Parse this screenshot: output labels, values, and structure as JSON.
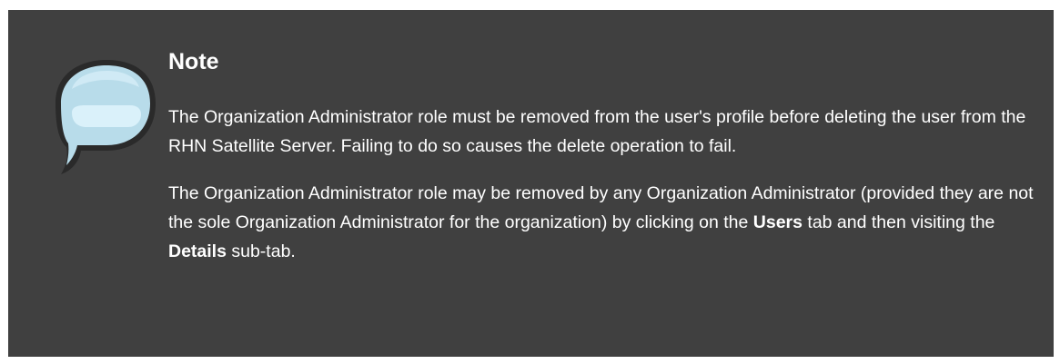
{
  "note": {
    "icon": "speech-bubble-icon",
    "title": "Note",
    "paragraph_1": "The Organization Administrator role must be removed from the user's profile before deleting the user from the RHN Satellite Server. Failing to do so causes the delete operation to fail.",
    "paragraph_2": {
      "text_before_users": "The Organization Administrator role may be removed by any Organization Administrator (provided they are not the sole Organization Administrator for the organization) by clicking on the ",
      "users": "Users",
      "text_between": " tab and then visiting the ",
      "details": "Details",
      "text_after": " sub-tab."
    }
  },
  "colors": {
    "background": "#404040",
    "text": "#ffffff",
    "icon_fill": "#bfe0ee",
    "icon_outline": "#2f2f2f"
  }
}
